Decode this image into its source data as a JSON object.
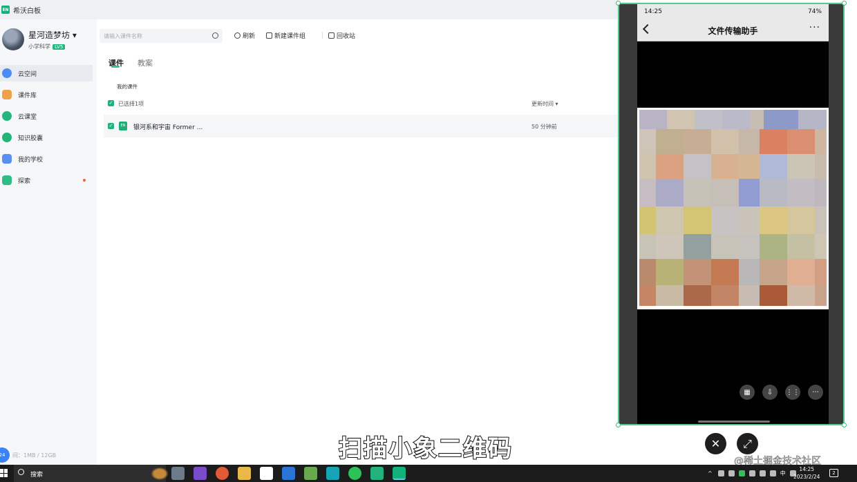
{
  "app": {
    "title": "希沃白板",
    "logo_text": "EN"
  },
  "user": {
    "name": "星河造梦坊",
    "subtitle": "小学科学",
    "level": "LV5"
  },
  "sidebar": {
    "items": [
      {
        "label": "云空间",
        "color": "#4a8df7"
      },
      {
        "label": "课件库",
        "color": "#f0a24a"
      },
      {
        "label": "云课堂",
        "color": "#26b57f"
      },
      {
        "label": "知识胶囊",
        "color": "#23b577"
      },
      {
        "label": "我的学校",
        "color": "#5b8ef2"
      },
      {
        "label": "探索",
        "color": "#2dbd85"
      }
    ],
    "storage_text": "间：1MB / 12GB",
    "storage_badge": "24"
  },
  "toolbar": {
    "search_placeholder": "请输入课件名称",
    "refresh_label": "刷新",
    "new_group_label": "新建课件组",
    "recycle_label": "回收站"
  },
  "tabs": [
    {
      "label": "课件"
    },
    {
      "label": "教案"
    }
  ],
  "breadcrumb": "我的课件",
  "list": {
    "selected_text": "已选择1项",
    "sort_label": "更新时间",
    "rows": [
      {
        "name": "银河系和宇宙 Former ...",
        "time": "50 分钟前",
        "icon_text": "EN"
      }
    ]
  },
  "phone": {
    "time": "14:25",
    "status_right": "74%",
    "title": "文件传输助手",
    "more": "···"
  },
  "video": {
    "subtitle": "扫描小象二维码",
    "watermark": "@稀土掘金技术社区"
  },
  "taskbar": {
    "search_label": "搜索",
    "ime": "中",
    "clock_time": "14:25",
    "clock_date": "2023/2/24",
    "notifications": "2"
  },
  "colors": {
    "accent": "#21b37b",
    "sidebar_bg": "#f6f7f9",
    "phone_border": "#55c98a"
  }
}
